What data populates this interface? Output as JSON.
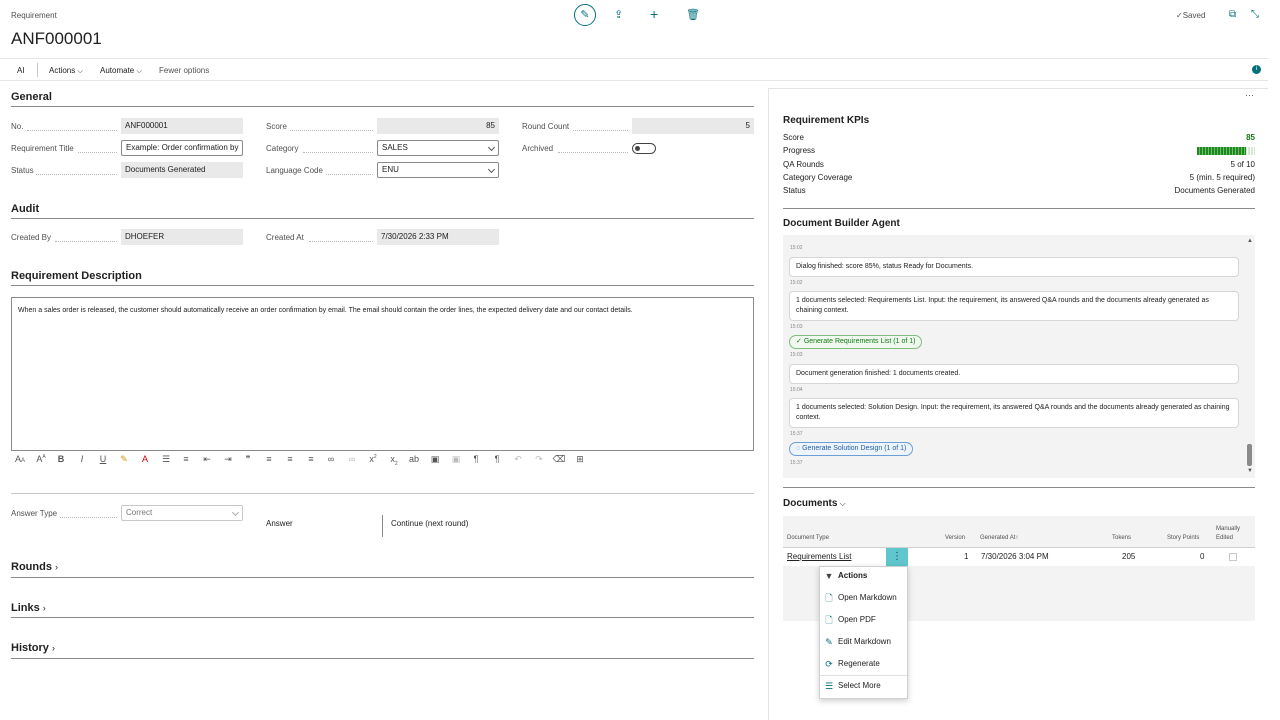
{
  "header": {
    "breadcrumb": "Requirement",
    "record_title": "ANF000001",
    "saved_label": "Saved"
  },
  "action_bar": {
    "items": [
      "AI",
      "Actions",
      "Automate",
      "Fewer options"
    ]
  },
  "general": {
    "title": "General",
    "no_label": "No.",
    "no_value": "ANF000001",
    "title_label": "Requirement Title",
    "title_value": "Example: Order confirmation by",
    "status_label": "Status",
    "status_value": "Documents Generated",
    "score_label": "Score",
    "score_value": "85",
    "category_label": "Category",
    "category_value": "SALES",
    "language_label": "Language Code",
    "language_value": "ENU",
    "round_label": "Round Count",
    "round_value": "5",
    "archived_label": "Archived"
  },
  "audit": {
    "title": "Audit",
    "created_by_label": "Created By",
    "created_by_value": "DHOEFER",
    "created_at_label": "Created At",
    "created_at_value": "7/30/2026 2:33 PM"
  },
  "description": {
    "title": "Requirement Description",
    "text": "When a sales order is released, the customer should automatically receive an order confirmation by email. The email should contain the order lines, the expected delivery date and our contact details."
  },
  "answer": {
    "type_label": "Answer Type",
    "type_value": "Correct",
    "answer_label": "Answer",
    "answer_value": "Continue (next round)"
  },
  "collapsed_sections": [
    "Rounds",
    "Links",
    "History"
  ],
  "kpis": {
    "title": "Requirement KPIs",
    "score_label": "Score",
    "score_value": "85",
    "progress_label": "Progress",
    "progress_fraction": 0.85,
    "qa_label": "QA Rounds",
    "qa_value": "5 of 10",
    "coverage_label": "Category Coverage",
    "coverage_value": "5 (min. 5 required)",
    "status_label": "Status",
    "status_value": "Documents Generated"
  },
  "agent": {
    "title": "Document Builder Agent",
    "ts1": "15:02",
    "msg1": "Dialog finished: score 85%, status Ready for Documents.",
    "ts2": "15:02",
    "msg2": "1 documents selected: Requirements List. Input: the requirement, its answered Q&A rounds and the documents already generated as chaining context.",
    "ts3": "15:03",
    "pill1": "Generate Requirements List (1 of 1)",
    "ts4": "15:03",
    "msg3": "Document generation finished: 1 documents created.",
    "ts5": "15:04",
    "msg4": "1 documents selected: Solution Design. Input: the requirement, its answered Q&A rounds and the documents already generated as chaining context.",
    "ts6": "15:37",
    "pill2": "Generate Solution Design (1 of 1)",
    "ts7": "15:37"
  },
  "documents": {
    "title": "Documents",
    "columns": [
      "Document Type",
      "Version",
      "Generated At",
      "Tokens",
      "Story Points",
      "Manually Edited"
    ],
    "row": {
      "type": "Requirements List",
      "version": "1",
      "generated_at": "7/30/2026 3:04 PM",
      "tokens": "205",
      "story_points": "0"
    }
  },
  "context_menu": {
    "header": "Actions",
    "items": [
      "Open Markdown",
      "Open PDF",
      "Edit Markdown",
      "Regenerate",
      "Select More"
    ]
  }
}
